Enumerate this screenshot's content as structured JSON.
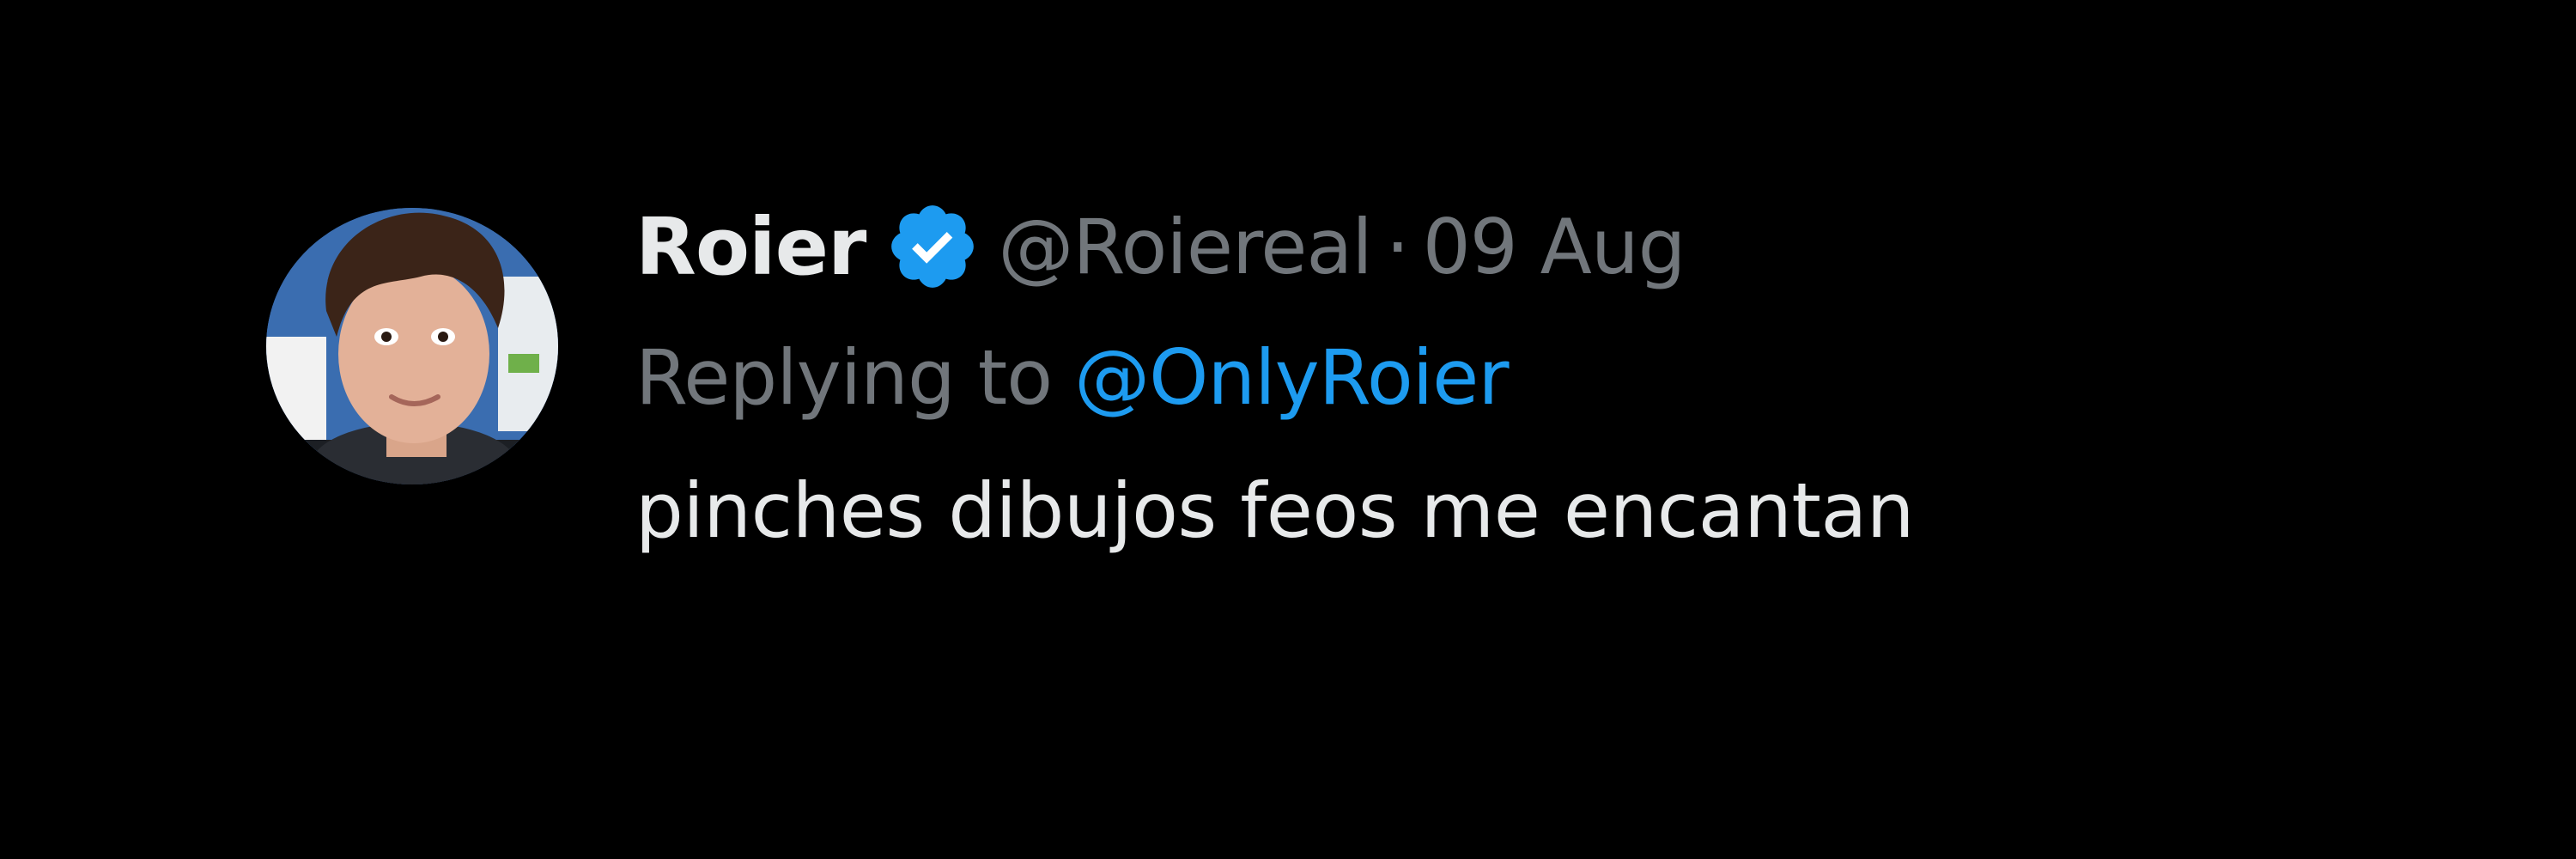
{
  "tweet": {
    "display_name": "Roier",
    "verified_icon": "verified-badge-icon",
    "handle": "@Roiereal",
    "separator": "·",
    "date": "09 Aug",
    "replying_prefix": "Replying to",
    "replying_handle": "@OnlyRoier",
    "text": "pinches dibujos feos me encantan"
  },
  "colors": {
    "background": "#000000",
    "primary_text": "#e7e9ea",
    "secondary_text": "#71767b",
    "link": "#1d9bf0",
    "verified_badge": "#1d9bf0"
  }
}
